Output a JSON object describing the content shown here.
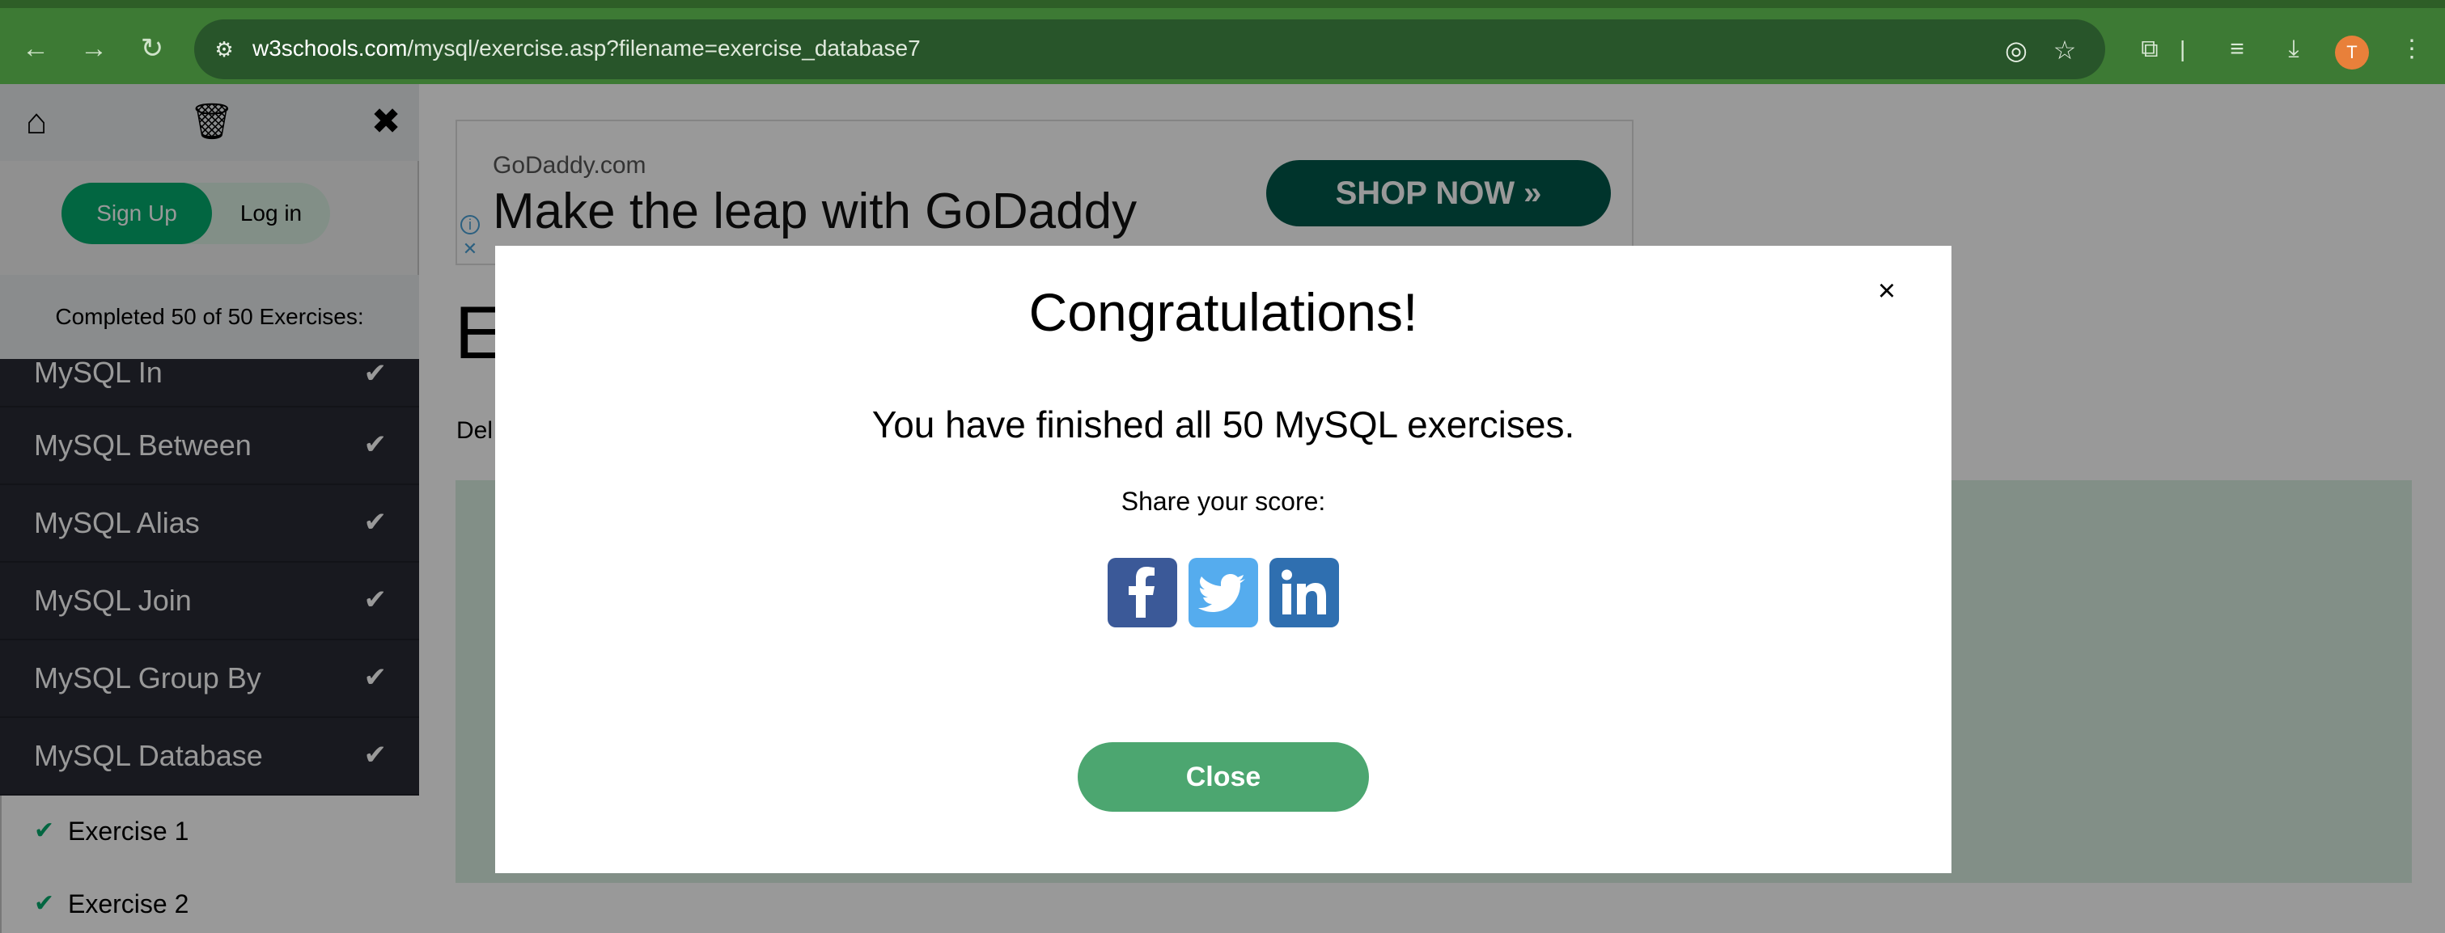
{
  "browser": {
    "url_domain": "w3schools.com",
    "url_path": "/mysql/exercise.asp?filename=exercise_database7",
    "profile_initial": "T"
  },
  "sidebar": {
    "signup_label": "Sign Up",
    "login_label": "Log in",
    "completed_text": "Completed 50 of 50 Exercises:",
    "menu_items": [
      {
        "label": "MySQL In"
      },
      {
        "label": "MySQL Between"
      },
      {
        "label": "MySQL Alias"
      },
      {
        "label": "MySQL Join"
      },
      {
        "label": "MySQL Group By"
      },
      {
        "label": "MySQL Database"
      }
    ],
    "sub_items": [
      {
        "label": "Exercise 1"
      },
      {
        "label": "Exercise 2"
      }
    ]
  },
  "ad": {
    "domain": "GoDaddy.com",
    "headline": "Make the leap with GoDaddy",
    "cta": "SHOP NOW »"
  },
  "main": {
    "heading": "E",
    "description": "Del"
  },
  "modal": {
    "title": "Congratulations!",
    "message": "You have finished all 50 MySQL exercises.",
    "share_label": "Share your score:",
    "close_x": "×",
    "close_label": "Close"
  },
  "colors": {
    "chrome": "#3d7a34",
    "accent_green": "#04aa6d",
    "sidebar_dark": "#282a35",
    "facebook": "#3b5998",
    "twitter": "#55acee",
    "linkedin": "#2f6fb0"
  }
}
